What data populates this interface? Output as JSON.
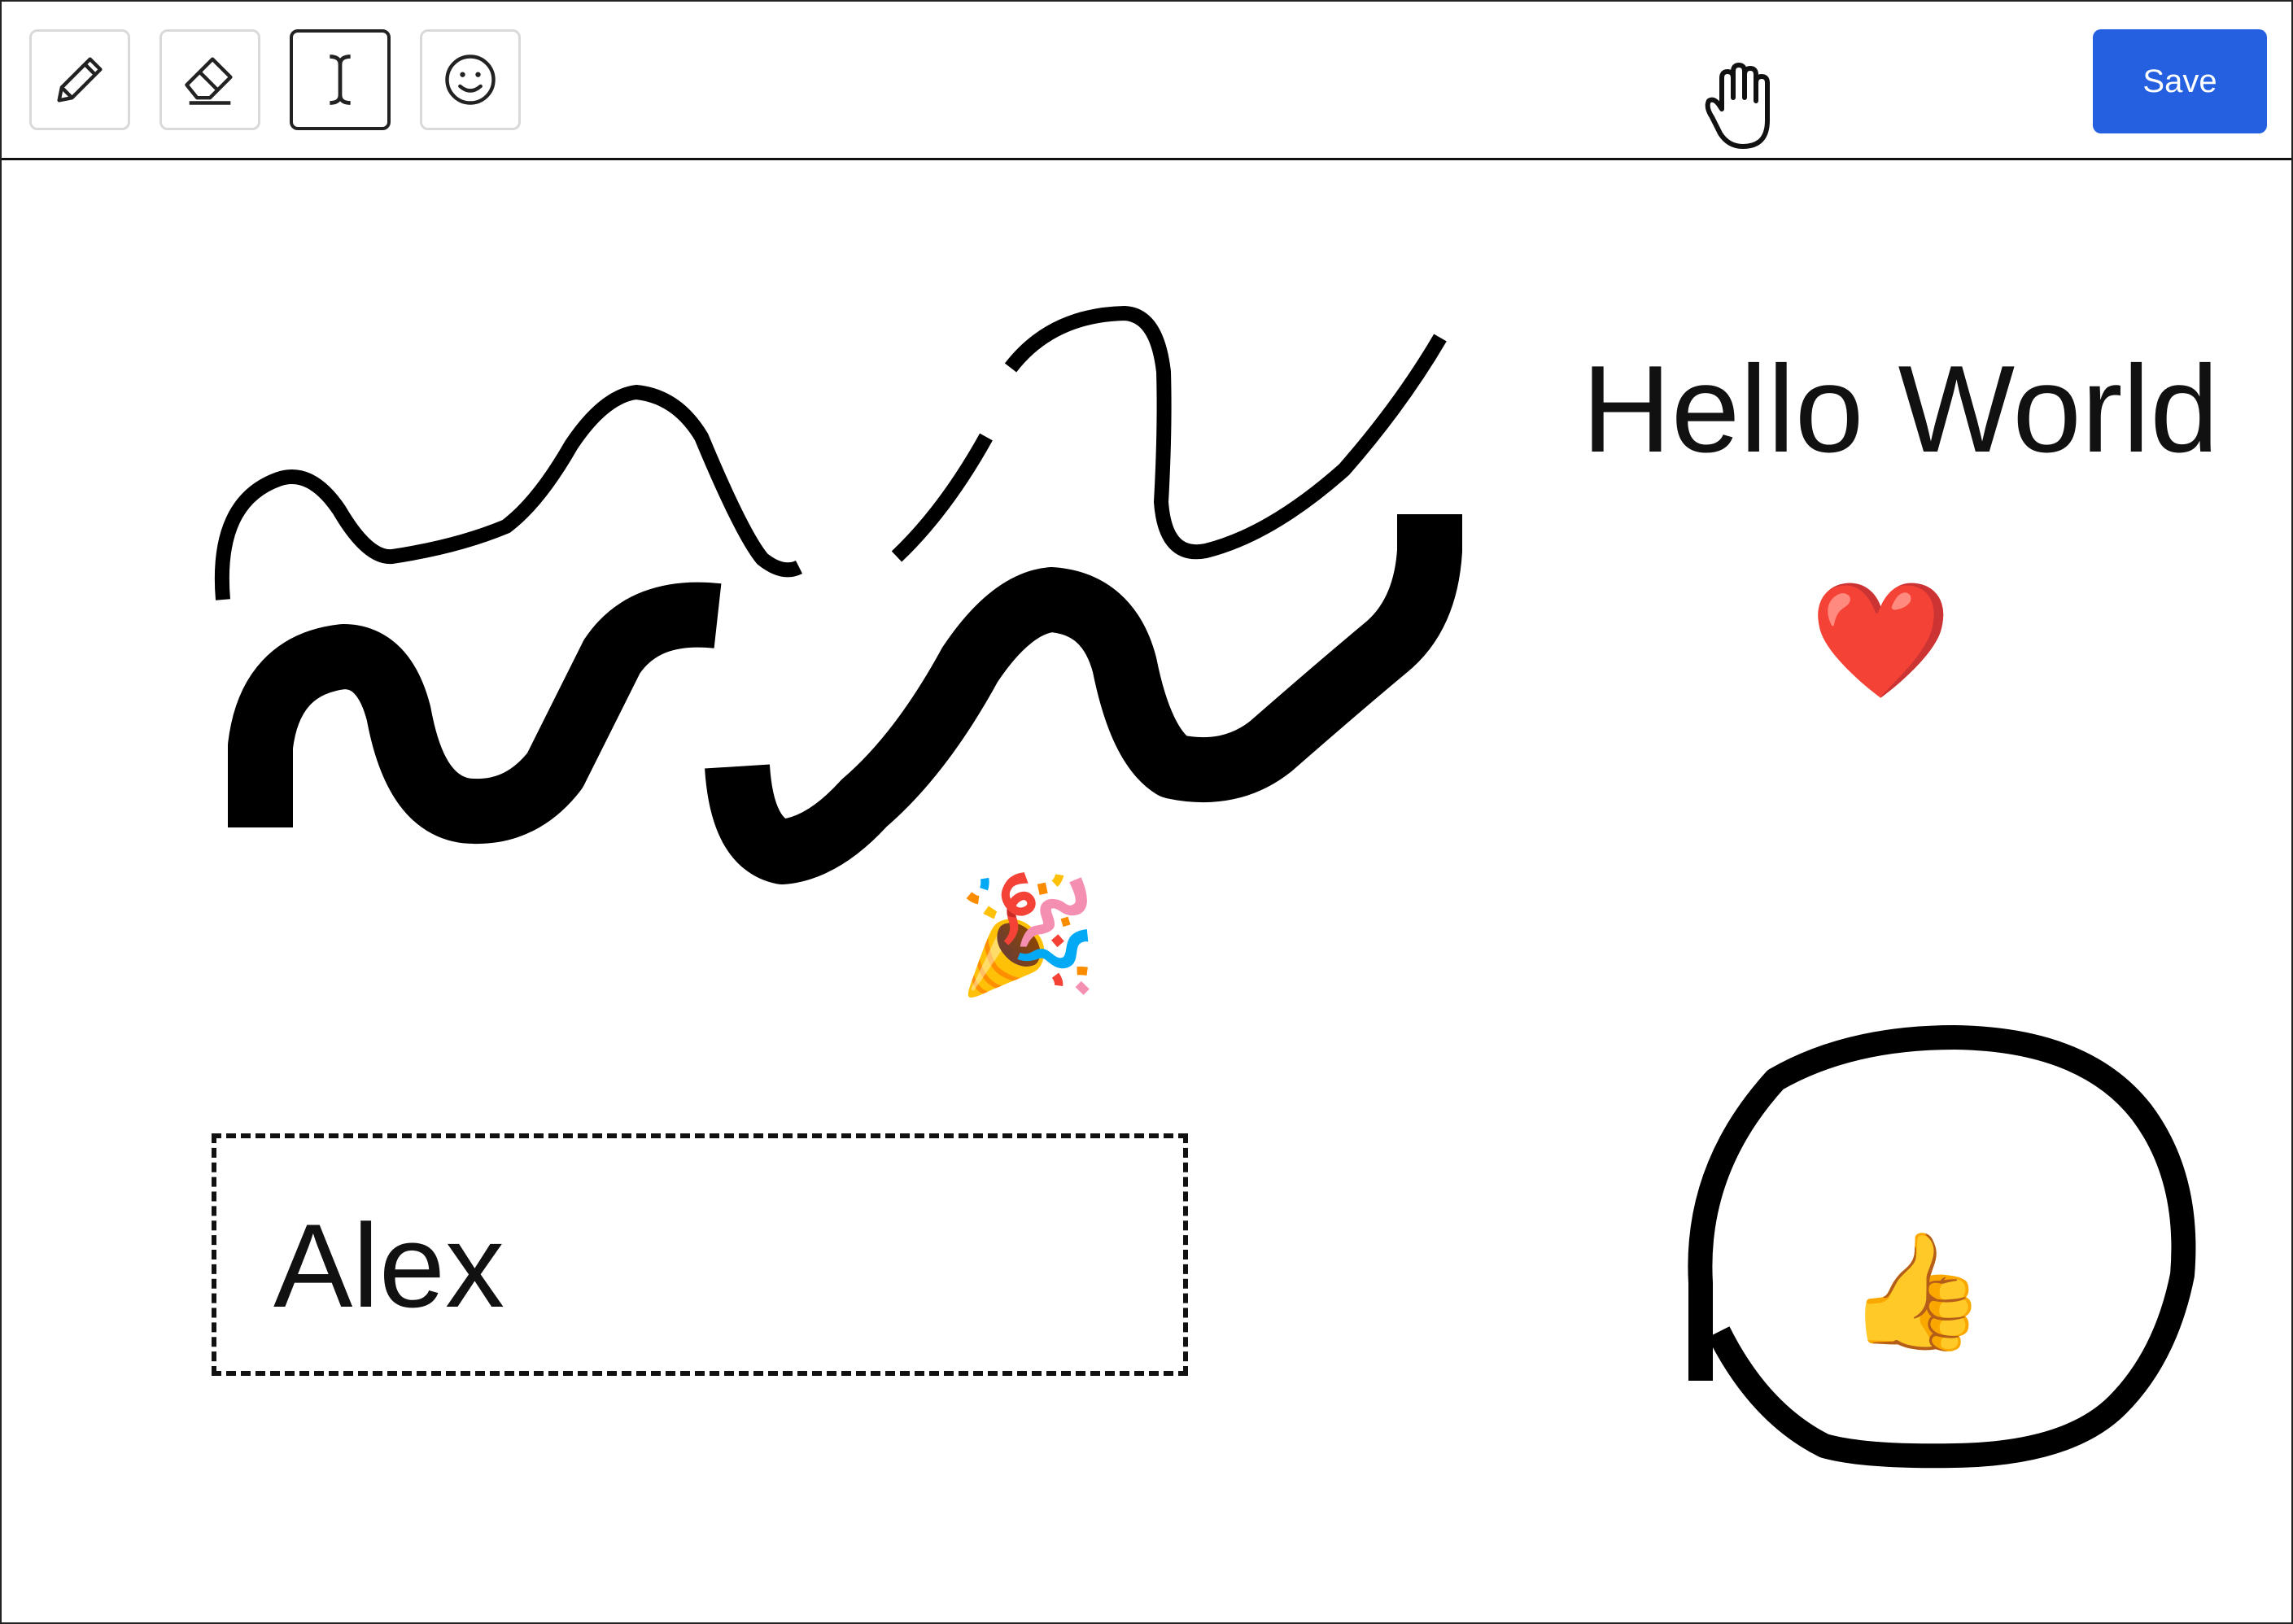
{
  "toolbar": {
    "tools": [
      {
        "name": "pencil",
        "icon": "pencil-icon",
        "active": false
      },
      {
        "name": "eraser",
        "icon": "eraser-icon",
        "active": false
      },
      {
        "name": "text",
        "icon": "text-cursor-icon",
        "active": true
      },
      {
        "name": "emoji",
        "icon": "smiley-icon",
        "active": false
      }
    ],
    "save_label": "Save",
    "cursor_icon": "hand-grab-icon"
  },
  "canvas": {
    "text_items": {
      "hello": "Hello World",
      "name": "Alex"
    },
    "emojis": {
      "heart": "❤️",
      "party": "🎉",
      "thumbs_up": "👍"
    }
  },
  "colors": {
    "accent": "#2460e0",
    "ink": "#111111",
    "tool_border": "#d9d9d9"
  }
}
